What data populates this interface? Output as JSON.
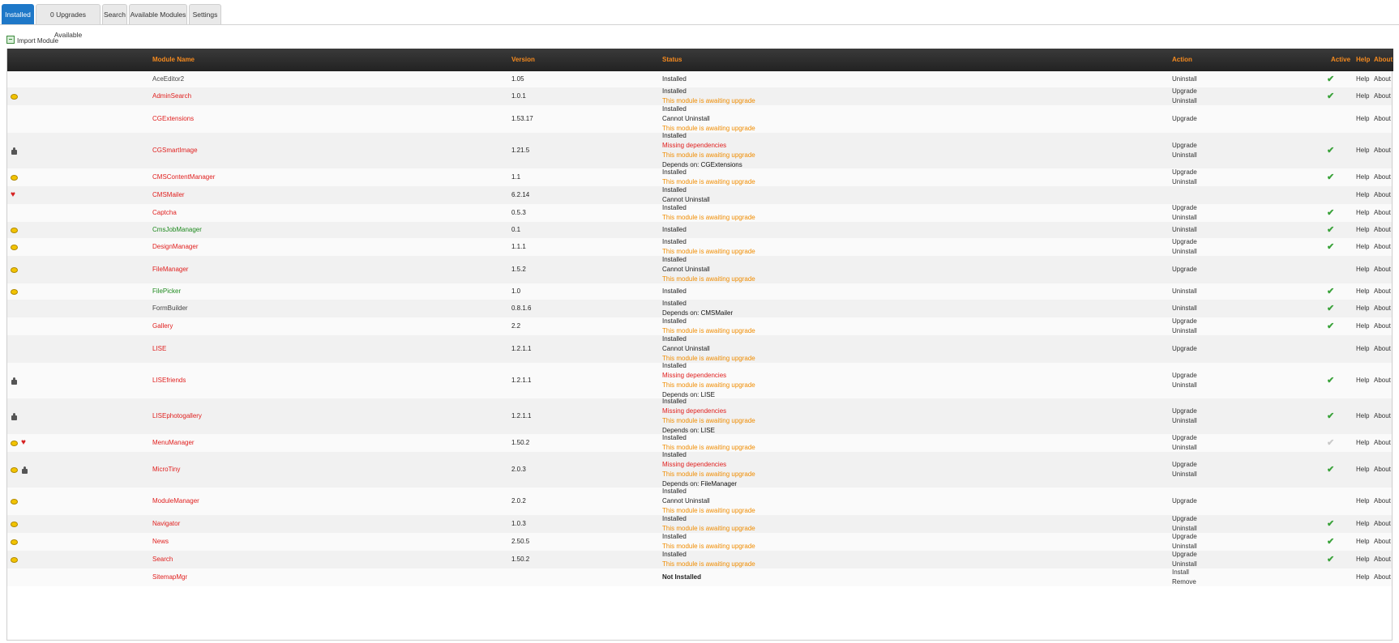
{
  "tabs": [
    "Installed",
    "0 Upgrades Available",
    "Search",
    "Available Modules",
    "Settings"
  ],
  "import_label": "Import Module",
  "columns": {
    "name": "Module Name",
    "version": "Version",
    "status": "Status",
    "action": "Action",
    "active": "Active",
    "help": "Help",
    "about": "About"
  },
  "help_label": "Help",
  "about_label": "About",
  "icon_names": {
    "coin": "coin-icon",
    "puzzle": "puzzle-piece-icon",
    "heart": "heart-icon"
  },
  "colors": {
    "tab_active": "#1e78c8",
    "header_text": "#f58a1f",
    "name_red": "#e0201f",
    "name_green": "#1f8a1f",
    "awaiting": "#f08c00",
    "check": "#3aa23a"
  },
  "modules": [
    {
      "name": "AceEditor2",
      "name_color": "gray",
      "version": "1.05",
      "status": [
        {
          "t": "Installed"
        }
      ],
      "actions": [
        "Uninstall"
      ],
      "active": "on",
      "icons": []
    },
    {
      "name": "AdminSearch",
      "name_color": "red",
      "version": "1.0.1",
      "status": [
        {
          "t": "Installed"
        },
        {
          "t": "This module is awaiting upgrade",
          "c": "orange"
        }
      ],
      "actions": [
        "Upgrade",
        "Uninstall"
      ],
      "active": "on",
      "icons": [
        "coin"
      ]
    },
    {
      "name": "CGExtensions",
      "name_color": "red",
      "version": "1.53.17",
      "status": [
        {
          "t": "Installed"
        },
        {
          "t": "Cannot Uninstall"
        },
        {
          "t": "This module is awaiting upgrade",
          "c": "orange"
        }
      ],
      "actions": [
        "Upgrade"
      ],
      "active": "",
      "icons": []
    },
    {
      "name": "CGSmartImage",
      "name_color": "red",
      "version": "1.21.5",
      "status": [
        {
          "t": "Installed"
        },
        {
          "t": "Missing dependencies",
          "c": "missing"
        },
        {
          "t": "This module is awaiting upgrade",
          "c": "orange"
        },
        {
          "t": "Depends on:",
          "dep": "CGExtensions"
        }
      ],
      "actions": [
        "Upgrade",
        "Uninstall"
      ],
      "active": "on",
      "icons": [
        "puzzle"
      ]
    },
    {
      "name": "CMSContentManager",
      "name_color": "red",
      "version": "1.1",
      "status": [
        {
          "t": "Installed"
        },
        {
          "t": "This module is awaiting upgrade",
          "c": "orange"
        }
      ],
      "actions": [
        "Upgrade",
        "Uninstall"
      ],
      "active": "on",
      "icons": [
        "coin"
      ]
    },
    {
      "name": "CMSMailer",
      "name_color": "red",
      "version": "6.2.14",
      "status": [
        {
          "t": "Installed"
        },
        {
          "t": "Cannot Uninstall"
        }
      ],
      "actions": [],
      "active": "",
      "icons": [
        "heart"
      ]
    },
    {
      "name": "Captcha",
      "name_color": "red",
      "version": "0.5.3",
      "status": [
        {
          "t": "Installed"
        },
        {
          "t": "This module is awaiting upgrade",
          "c": "orange"
        }
      ],
      "actions": [
        "Upgrade",
        "Uninstall"
      ],
      "active": "on",
      "icons": []
    },
    {
      "name": "CmsJobManager",
      "name_color": "green",
      "version": "0.1",
      "status": [
        {
          "t": "Installed"
        }
      ],
      "actions": [
        "Uninstall"
      ],
      "active": "on",
      "icons": [
        "coin"
      ]
    },
    {
      "name": "DesignManager",
      "name_color": "red",
      "version": "1.1.1",
      "status": [
        {
          "t": "Installed"
        },
        {
          "t": "This module is awaiting upgrade",
          "c": "orange"
        }
      ],
      "actions": [
        "Upgrade",
        "Uninstall"
      ],
      "active": "on",
      "icons": [
        "coin"
      ]
    },
    {
      "name": "FileManager",
      "name_color": "red",
      "version": "1.5.2",
      "status": [
        {
          "t": "Installed"
        },
        {
          "t": "Cannot Uninstall"
        },
        {
          "t": "This module is awaiting upgrade",
          "c": "orange"
        }
      ],
      "actions": [
        "Upgrade"
      ],
      "active": "",
      "icons": [
        "coin"
      ]
    },
    {
      "name": "FilePicker",
      "name_color": "green",
      "version": "1.0",
      "status": [
        {
          "t": "Installed"
        }
      ],
      "actions": [
        "Uninstall"
      ],
      "active": "on",
      "icons": [
        "coin"
      ]
    },
    {
      "name": "FormBuilder",
      "name_color": "gray",
      "version": "0.8.1.6",
      "status": [
        {
          "t": "Installed"
        },
        {
          "t": "Depends on:",
          "dep": "CMSMailer"
        }
      ],
      "actions": [
        "Uninstall"
      ],
      "active": "on",
      "icons": []
    },
    {
      "name": "Gallery",
      "name_color": "red",
      "version": "2.2",
      "status": [
        {
          "t": "Installed"
        },
        {
          "t": "This module is awaiting upgrade",
          "c": "orange"
        }
      ],
      "actions": [
        "Upgrade",
        "Uninstall"
      ],
      "active": "on",
      "icons": []
    },
    {
      "name": "LISE",
      "name_color": "red",
      "version": "1.2.1.1",
      "status": [
        {
          "t": "Installed"
        },
        {
          "t": "Cannot Uninstall"
        },
        {
          "t": "This module is awaiting upgrade",
          "c": "orange"
        }
      ],
      "actions": [
        "Upgrade"
      ],
      "active": "",
      "icons": []
    },
    {
      "name": "LISEfriends",
      "name_color": "red",
      "version": "1.2.1.1",
      "status": [
        {
          "t": "Installed"
        },
        {
          "t": "Missing dependencies",
          "c": "missing"
        },
        {
          "t": "This module is awaiting upgrade",
          "c": "orange"
        },
        {
          "t": "Depends on:",
          "dep": "LISE"
        }
      ],
      "actions": [
        "Upgrade",
        "Uninstall"
      ],
      "active": "on",
      "icons": [
        "puzzle"
      ]
    },
    {
      "name": "LISEphotogallery",
      "name_color": "red",
      "version": "1.2.1.1",
      "status": [
        {
          "t": "Installed"
        },
        {
          "t": "Missing dependencies",
          "c": "missing"
        },
        {
          "t": "This module is awaiting upgrade",
          "c": "orange"
        },
        {
          "t": "Depends on:",
          "dep": "LISE"
        }
      ],
      "actions": [
        "Upgrade",
        "Uninstall"
      ],
      "active": "on",
      "icons": [
        "puzzle"
      ]
    },
    {
      "name": "MenuManager",
      "name_color": "red",
      "version": "1.50.2",
      "status": [
        {
          "t": "Installed"
        },
        {
          "t": "This module is awaiting upgrade",
          "c": "orange"
        }
      ],
      "actions": [
        "Upgrade",
        "Uninstall"
      ],
      "active": "off",
      "icons": [
        "coin",
        "heart"
      ]
    },
    {
      "name": "MicroTiny",
      "name_color": "red",
      "version": "2.0.3",
      "status": [
        {
          "t": "Installed"
        },
        {
          "t": "Missing dependencies",
          "c": "missing"
        },
        {
          "t": "This module is awaiting upgrade",
          "c": "orange"
        },
        {
          "t": "Depends on:",
          "dep": "FileManager"
        }
      ],
      "actions": [
        "Upgrade",
        "Uninstall"
      ],
      "active": "on",
      "icons": [
        "coin",
        "puzzle"
      ]
    },
    {
      "name": "ModuleManager",
      "name_color": "red",
      "version": "2.0.2",
      "status": [
        {
          "t": "Installed"
        },
        {
          "t": "Cannot Uninstall"
        },
        {
          "t": "This module is awaiting upgrade",
          "c": "orange"
        }
      ],
      "actions": [
        "Upgrade"
      ],
      "active": "",
      "icons": [
        "coin"
      ]
    },
    {
      "name": "Navigator",
      "name_color": "red",
      "version": "1.0.3",
      "status": [
        {
          "t": "Installed"
        },
        {
          "t": "This module is awaiting upgrade",
          "c": "orange"
        }
      ],
      "actions": [
        "Upgrade",
        "Uninstall"
      ],
      "active": "on",
      "icons": [
        "coin"
      ]
    },
    {
      "name": "News",
      "name_color": "red",
      "version": "2.50.5",
      "status": [
        {
          "t": "Installed"
        },
        {
          "t": "This module is awaiting upgrade",
          "c": "orange"
        }
      ],
      "actions": [
        "Upgrade",
        "Uninstall"
      ],
      "active": "on",
      "icons": [
        "coin"
      ]
    },
    {
      "name": "Search",
      "name_color": "red",
      "version": "1.50.2",
      "status": [
        {
          "t": "Installed"
        },
        {
          "t": "This module is awaiting upgrade",
          "c": "orange"
        }
      ],
      "actions": [
        "Upgrade",
        "Uninstall"
      ],
      "active": "on",
      "icons": [
        "coin"
      ]
    },
    {
      "name": "SitemapMgr",
      "name_color": "red",
      "version": "",
      "status": [
        {
          "t": "Not Installed",
          "bold": true
        }
      ],
      "actions": [
        "Install",
        "Remove"
      ],
      "active": "",
      "icons": []
    }
  ]
}
